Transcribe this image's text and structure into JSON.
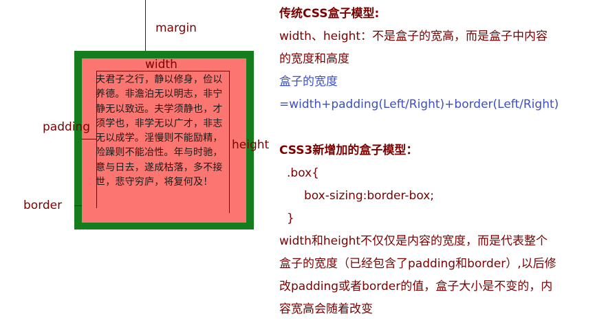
{
  "diagram": {
    "margin_label": "margin",
    "width_label": "width",
    "padding_label": "padding",
    "height_label": "height",
    "border_label": "border",
    "content_text": "夫君子之行，静以修身，俭以养德。非澹泊无以明志，非宁静无以致远。夫学须静也，才须学也，非学无以广才，非志无以成学。淫慢则不能励精，险躁则不能冶性。年与时驰，意与日去，遂成枯落，多不接世，悲守穷庐，将复何及！",
    "colors": {
      "border": "#157d1e",
      "padding": "#fb7670",
      "label": "#7a0000"
    }
  },
  "panel": {
    "traditional_title": "传统CSS盒子模型:",
    "traditional_line1": "width、height：不是盒子的宽高，而是盒子中内容",
    "traditional_line2": "的宽度和高度",
    "box_width_label": "盒子的宽度",
    "box_width_formula": "=width+padding(Left/Right)+border(Left/Right)",
    "css3_title": "CSS3新增加的盒子模型：",
    "code_open": ".box{",
    "code_prop": "box-sizing:border-box;",
    "code_close": "}",
    "css3_desc_line1": "width和height不仅仅是内容的宽度，而是代表整个",
    "css3_desc_line2": "盒子的宽度（已经包含了padding和border）,以后修",
    "css3_desc_line3": "改padding或者border的值，盒子大小是不变的，内",
    "css3_desc_line4": "容宽高会随着改变",
    "colors": {
      "text": "#7a0000",
      "accent_blue": "#3b4fc2"
    }
  }
}
